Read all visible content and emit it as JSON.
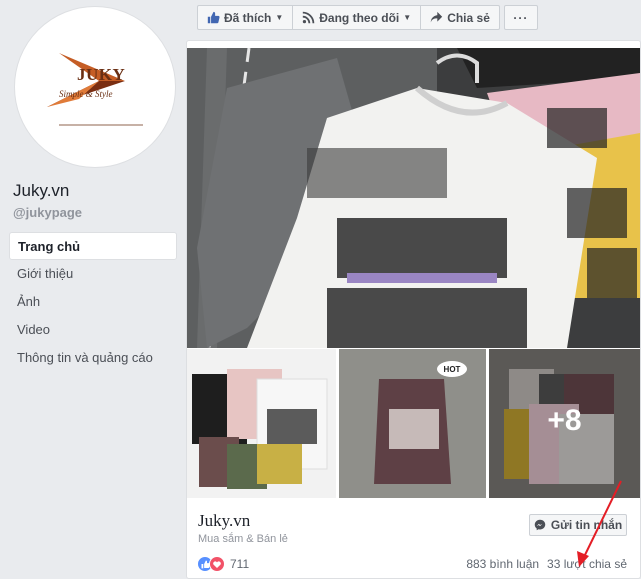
{
  "sidebar": {
    "logo": {
      "brand": "JUKY",
      "tagline": "Simple & Style"
    },
    "page_name": "Juky.vn",
    "handle": "@jukypage",
    "nav": [
      {
        "label": "Trang chủ",
        "active": true
      },
      {
        "label": "Giới thiệu"
      },
      {
        "label": "Ảnh"
      },
      {
        "label": "Video"
      },
      {
        "label": "Thông tin và quảng cáo"
      }
    ]
  },
  "actions": {
    "like": "Đã thích",
    "follow": "Đang theo dõi",
    "share": "Chia sẻ",
    "more": "···"
  },
  "card": {
    "plus_count": "+8",
    "hot_badge": "HOT",
    "title": "Juky.vn",
    "category": "Mua sắm & Bán lẻ",
    "message_button": "Gửi tin nhắn",
    "reaction_count": "711",
    "comments": "883 bình luận",
    "shares": "33 lượt chia sẻ"
  },
  "colors": {
    "accent": "#4267b2",
    "arrow": "#e41e26",
    "love": "#f25268",
    "like": "#5890ff"
  }
}
